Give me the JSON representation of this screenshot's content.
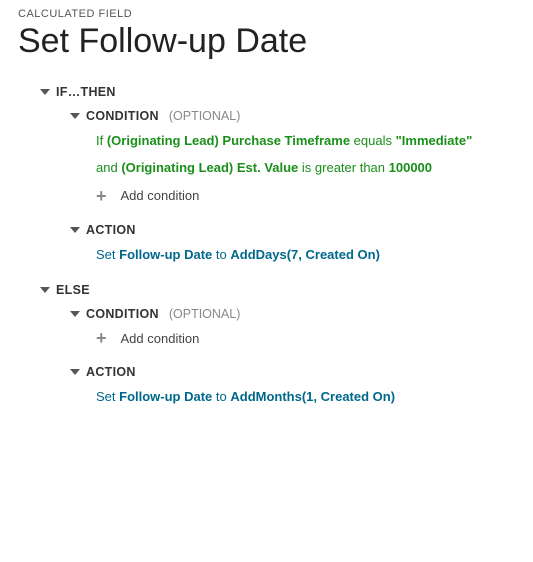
{
  "breadcrumb": "CALCULATED FIELD",
  "title": "Set Follow-up Date",
  "ifthen": {
    "label": "IF…THEN",
    "condition": {
      "label": "CONDITION",
      "optional": "(OPTIONAL)",
      "line1": {
        "if": "If ",
        "field": "(Originating Lead) Purchase Timeframe",
        "op": " equals ",
        "value": "\"Immediate\""
      },
      "line2": {
        "and": "and ",
        "field": "(Originating Lead) Est. Value",
        "op": " is greater than ",
        "value": "100000"
      },
      "add": "Add condition"
    },
    "action": {
      "label": "ACTION",
      "line": {
        "set": "Set ",
        "field": "Follow-up Date",
        "to": " to ",
        "func": "AddDays(7, Created On)"
      }
    }
  },
  "else": {
    "label": "ELSE",
    "condition": {
      "label": "CONDITION",
      "optional": "(OPTIONAL)",
      "add": "Add condition"
    },
    "action": {
      "label": "ACTION",
      "line": {
        "set": "Set ",
        "field": "Follow-up Date",
        "to": " to ",
        "func": "AddMonths(1, Created On)"
      }
    }
  }
}
